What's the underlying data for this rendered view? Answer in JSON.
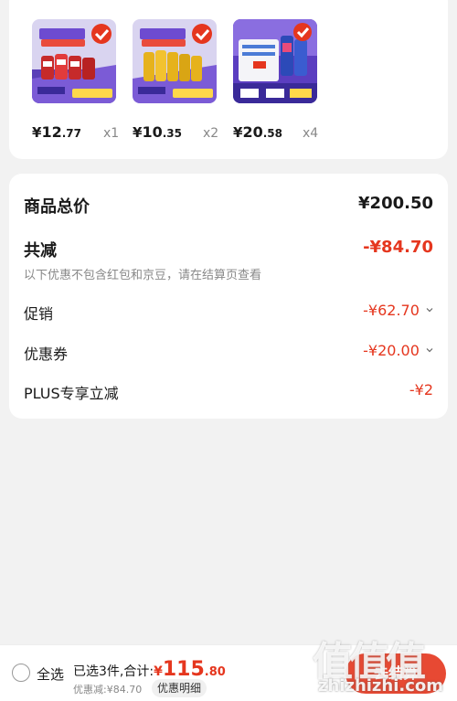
{
  "products": [
    {
      "name": "product-1",
      "price_cur": "¥",
      "price_int": "12",
      "price_dec": ".77",
      "qty": "x1",
      "theme": "red"
    },
    {
      "name": "product-2",
      "price_cur": "¥",
      "price_int": "10",
      "price_dec": ".35",
      "qty": "x2",
      "theme": "gold"
    },
    {
      "name": "product-3",
      "price_cur": "¥",
      "price_int": "20",
      "price_dec": ".58",
      "qty": "x4",
      "theme": "blue"
    }
  ],
  "summary": {
    "total_label": "商品总价",
    "total_value": "¥200.50",
    "reduce_label": "共减",
    "reduce_value": "-¥84.70",
    "reduce_note": "以下优惠不包含红包和京豆，请在结算页查看",
    "promo_label": "促销",
    "promo_value": "-¥62.70",
    "coupon_label": "优惠券",
    "coupon_value": "-¥20.00",
    "plus_label": "PLUS专享立减",
    "plus_value": "-¥2"
  },
  "bottom": {
    "select_all": "全选",
    "selected_text": "已选3件,合计:",
    "total_cur": "¥",
    "total_int": "115",
    "total_dec": ".80",
    "discount_text": "优惠减:¥84.70",
    "detail_label": "优惠明细",
    "checkout_label": "去结算"
  },
  "watermark": {
    "chars": "值值值",
    "url": "zhizhizhi.com"
  },
  "colors": {
    "accent": "#e5361e",
    "background": "#f2f2f2"
  }
}
